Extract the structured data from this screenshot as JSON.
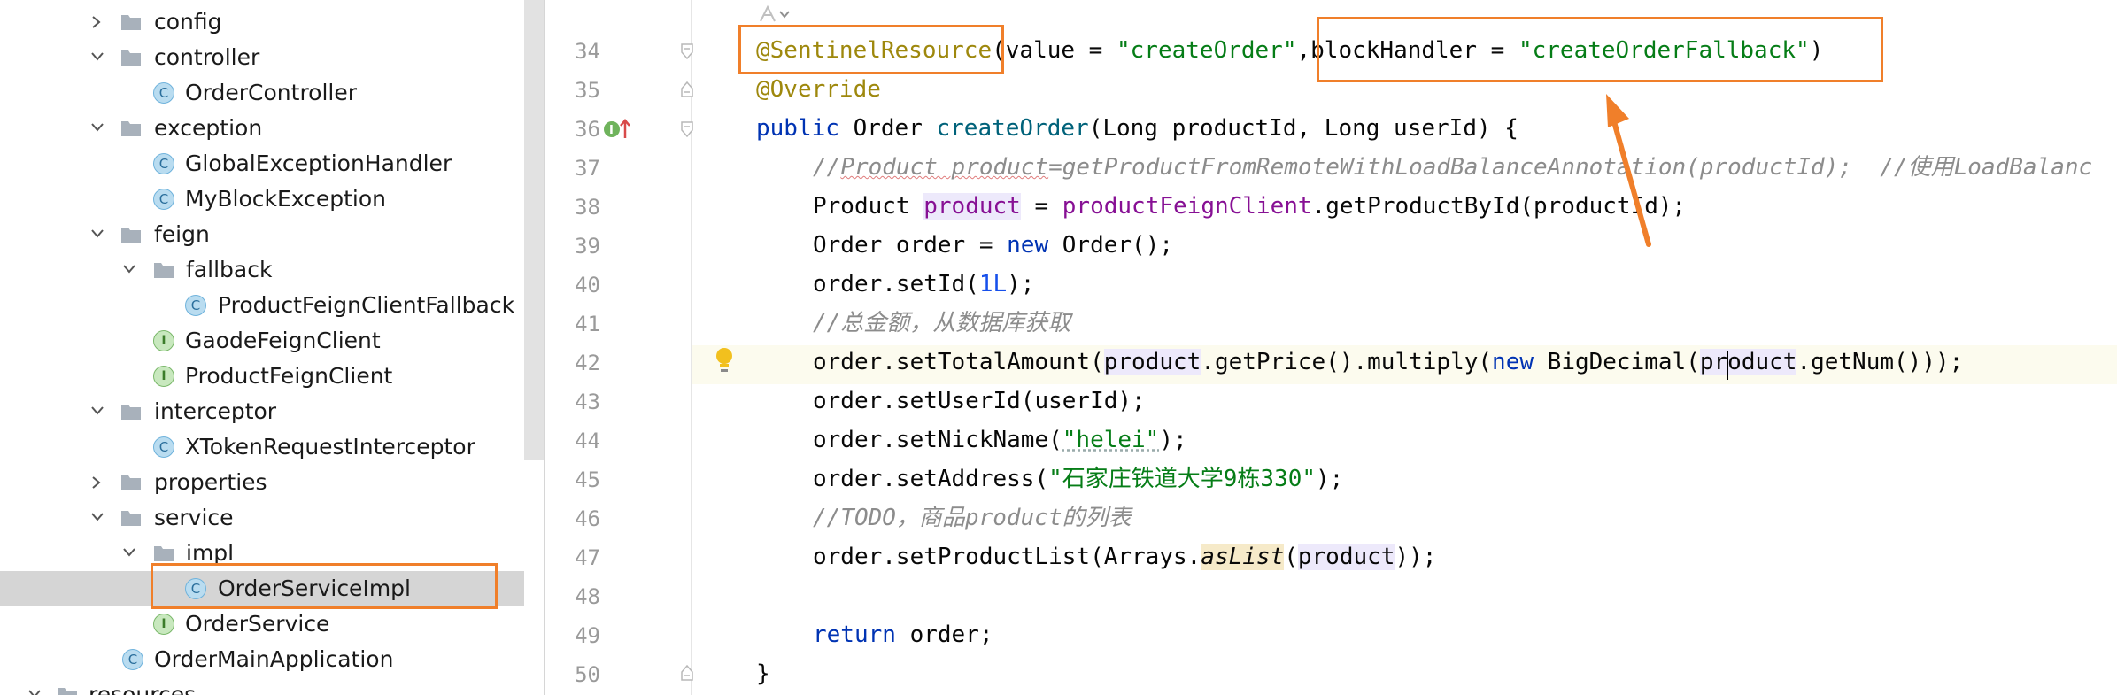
{
  "tree": {
    "items": [
      {
        "label": "config",
        "kind": "folder",
        "expanded": false,
        "indent": 0
      },
      {
        "label": "controller",
        "kind": "folder",
        "expanded": true,
        "indent": 0
      },
      {
        "label": "OrderController",
        "kind": "class",
        "indent": 1
      },
      {
        "label": "exception",
        "kind": "folder",
        "expanded": true,
        "indent": 0
      },
      {
        "label": "GlobalExceptionHandler",
        "kind": "class",
        "indent": 1
      },
      {
        "label": "MyBlockException",
        "kind": "class",
        "indent": 1
      },
      {
        "label": "feign",
        "kind": "folder",
        "expanded": true,
        "indent": 0
      },
      {
        "label": "fallback",
        "kind": "folder",
        "expanded": true,
        "indent": 1
      },
      {
        "label": "ProductFeignClientFallback",
        "kind": "class",
        "indent": 2
      },
      {
        "label": "GaodeFeignClient",
        "kind": "interface",
        "indent": 1
      },
      {
        "label": "ProductFeignClient",
        "kind": "interface",
        "indent": 1
      },
      {
        "label": "interceptor",
        "kind": "folder",
        "expanded": true,
        "indent": 0
      },
      {
        "label": "XTokenRequestInterceptor",
        "kind": "class",
        "indent": 1
      },
      {
        "label": "properties",
        "kind": "folder",
        "expanded": false,
        "indent": 0
      },
      {
        "label": "service",
        "kind": "folder",
        "expanded": true,
        "indent": 0
      },
      {
        "label": "impl",
        "kind": "folder",
        "expanded": true,
        "indent": 1
      },
      {
        "label": "OrderServiceImpl",
        "kind": "class",
        "indent": 2,
        "selected": true
      },
      {
        "label": "OrderService",
        "kind": "interface",
        "indent": 1
      },
      {
        "label": "OrderMainApplication",
        "kind": "class",
        "indent": 0
      },
      {
        "label": "resources",
        "kind": "folder",
        "expanded": true,
        "indent": -1
      }
    ]
  },
  "editor": {
    "line_numbers": [
      "34",
      "35",
      "36",
      "37",
      "38",
      "39",
      "40",
      "41",
      "42",
      "43",
      "44",
      "45",
      "46",
      "47",
      "48",
      "49",
      "50"
    ],
    "lines": {
      "l34": {
        "ann": "@SentinelResource",
        "p1": "(value = ",
        "s1": "\"createOrder\"",
        "p2": ",blockHandler = ",
        "s2": "\"createOrderFallback\"",
        "p3": ")"
      },
      "l35": {
        "ann": "@Override"
      },
      "l36": {
        "kw": "public",
        "p1": " Order ",
        "fn": "createOrder",
        "p2": "(Long productId, Long userId) {"
      },
      "l37": {
        "cm": "//",
        "sq": "Product product",
        "rest": "=getProductFromRemoteWithLoadBalanceAnnotation(productId);  //使用LoadBalanc"
      },
      "l38": {
        "p1": "Product ",
        "v1": "product",
        "p2": " = ",
        "f1": "productFeignClient",
        "p3": ".getProductById(productId);"
      },
      "l39": {
        "p1": "Order order = ",
        "kw": "new",
        "p2": " Order();"
      },
      "l40": {
        "p1": "order.setId(",
        "num": "1L",
        "p2": ");"
      },
      "l41": {
        "cm": "//总金额，从数据库获取"
      },
      "l42": {
        "p1": "order.setTotalAmount(",
        "v1": "product",
        "p2": ".getPrice().multiply(",
        "kw": "new",
        "p3": " BigDecimal(",
        "v2": "product",
        "p4": ".getNum()));"
      },
      "l43": {
        "p1": "order.setUserId(userId);"
      },
      "l44": {
        "p1": "order.setNickName(",
        "s1": "\"helei\"",
        "p2": ");"
      },
      "l45": {
        "p1": "order.setAddress(",
        "s1": "\"石家庄铁道大学9栋330\"",
        "p2": ");"
      },
      "l46": {
        "cm": "//TODO，商品product的列表"
      },
      "l47": {
        "p1": "order.setProductList(Arrays.",
        "st": "asList",
        "p2": "(",
        "v1": "product",
        "p3": "));"
      },
      "l49": {
        "kw": "return",
        "p1": " order;"
      },
      "l50": {
        "p1": "}"
      }
    }
  },
  "colors": {
    "highlight_box": "#f07f2a",
    "selection": "#d5d5d5",
    "arrow": "#f07f2a"
  }
}
